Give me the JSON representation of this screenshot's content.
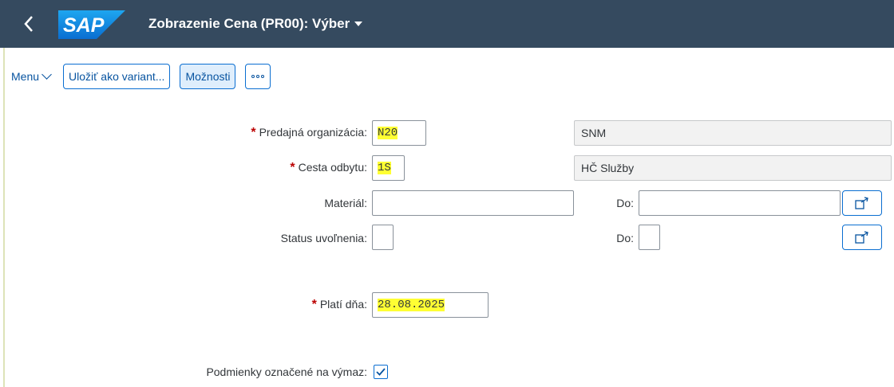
{
  "shell": {
    "logo_text": "SAP",
    "title": "Zobrazenie Cena (PR00): Výber",
    "colors": {
      "shell_bg": "#354a5f",
      "logo_blue": "#0a6ed1",
      "accent": "#0854a0",
      "highlight": "#ffff33",
      "required": "#bb0000"
    }
  },
  "toolbar": {
    "menu_label": "Menu",
    "save_variant_label": "Uložiť ako variant...",
    "options_label": "Možnosti"
  },
  "form": {
    "sales_org": {
      "required_mark": "*",
      "label": "Predajná organizácia:",
      "value": "N20",
      "description": "SNM"
    },
    "distribution_channel": {
      "required_mark": "*",
      "label": "Cesta odbytu:",
      "value": "1S",
      "description": "HČ Služby"
    },
    "material": {
      "label": "Materiál:",
      "value": "",
      "to_label": "Do:",
      "to_value": ""
    },
    "release_status": {
      "label": "Status uvoľnenia:",
      "value": "",
      "to_label": "Do:",
      "to_value": ""
    },
    "valid_on": {
      "required_mark": "*",
      "label": "Platí dňa:",
      "value": "28.08.2025"
    },
    "deletion_flag": {
      "label": "Podmienky označené na výmaz:",
      "checked": true
    }
  }
}
